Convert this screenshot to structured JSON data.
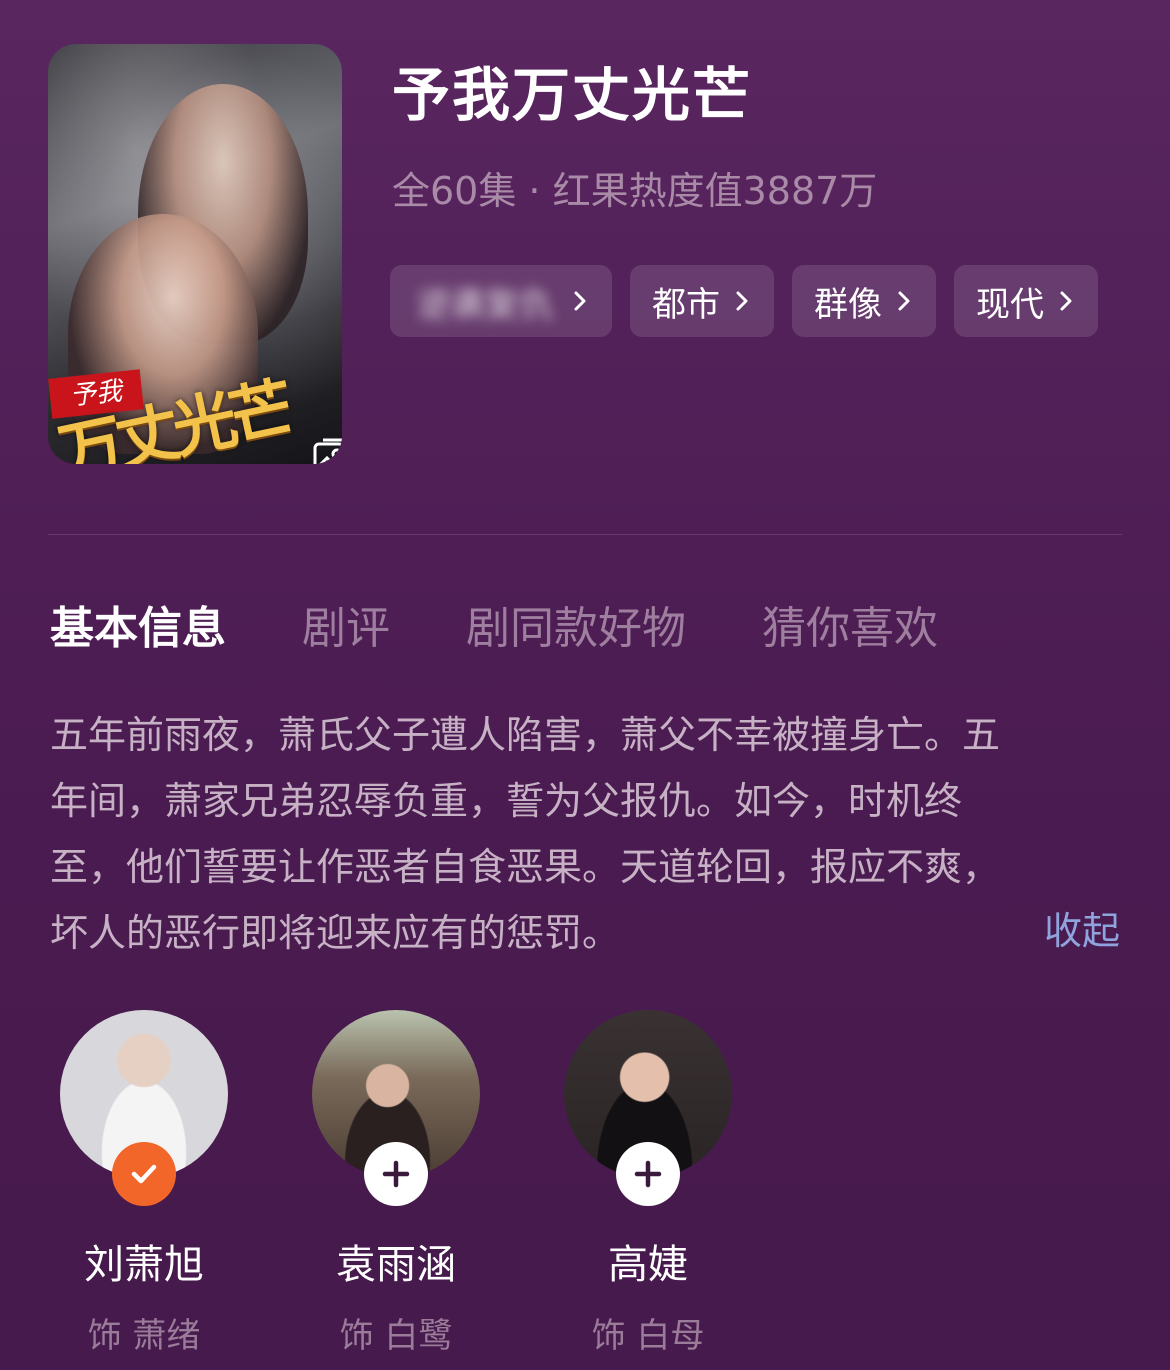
{
  "drama": {
    "title": "予我万丈光芒",
    "meta": "全60集 · 红果热度值3887万",
    "poster": {
      "ribbon_text": "予我",
      "title_text": "万丈光芒"
    }
  },
  "tags": [
    {
      "label": "逆袭复仇",
      "blurred": true
    },
    {
      "label": "都市",
      "blurred": false
    },
    {
      "label": "群像",
      "blurred": false
    },
    {
      "label": "现代",
      "blurred": false
    }
  ],
  "tabs": [
    {
      "label": "基本信息",
      "active": true
    },
    {
      "label": "剧评",
      "active": false
    },
    {
      "label": "剧同款好物",
      "active": false
    },
    {
      "label": "猜你喜欢",
      "active": false
    }
  ],
  "synopsis": {
    "lines": [
      "五年前雨夜，萧氏父子遭人陷害，萧父不幸被撞身亡。五",
      "年间，萧家兄弟忍辱负重，誓为父报仇。如今，时机终",
      "至，他们誓要让作恶者自食恶果。天道轮回，报应不爽，",
      "坏人的恶行即将迎来应有的惩罚。"
    ],
    "collapse_label": "收起"
  },
  "cast": [
    {
      "name": "刘萧旭",
      "role": "饰 萧绪",
      "followed": true
    },
    {
      "name": "袁雨涵",
      "role": "饰 白鹭",
      "followed": false
    },
    {
      "name": "高婕",
      "role": "饰 白母",
      "followed": false
    }
  ],
  "colors": {
    "background": "#4f1f56",
    "accent_follow": "#f2662a",
    "collapse_link": "#8fa4dd",
    "muted_text": "#a98ba8"
  }
}
